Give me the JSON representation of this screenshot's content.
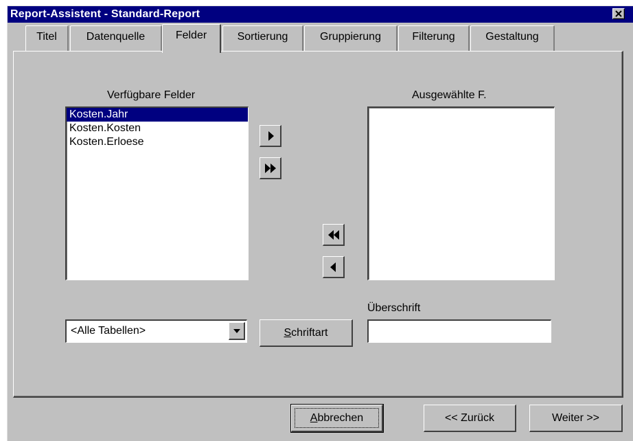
{
  "window": {
    "title": "Report-Assistent - Standard-Report"
  },
  "tabs": [
    {
      "label": "Titel"
    },
    {
      "label": "Datenquelle"
    },
    {
      "label": "Felder",
      "active": true
    },
    {
      "label": "Sortierung"
    },
    {
      "label": "Gruppierung"
    },
    {
      "label": "Filterung"
    },
    {
      "label": "Gestaltung"
    }
  ],
  "fields": {
    "available_label": "Verfügbare Felder",
    "available_items": [
      "Kosten.Jahr",
      "Kosten.Kosten",
      "Kosten.Erloese"
    ],
    "selected_item_index": 0,
    "selected_label": "Ausgewählte F.",
    "selected_items": []
  },
  "table_filter": {
    "value": "<Alle Tabellen>"
  },
  "font_button": {
    "label": "Schriftart",
    "mnemonic": "S"
  },
  "caption": {
    "label": "Überschrift",
    "value": ""
  },
  "footer": {
    "cancel_label": "Abbrechen",
    "cancel_mnemonic": "A",
    "back_label": "<< Zurück",
    "next_label": "Weiter >>"
  },
  "icons": {
    "close": "close-icon",
    "add_one": "arrow-right-icon",
    "add_all": "double-arrow-right-icon",
    "remove_all": "double-arrow-left-icon",
    "remove_one": "arrow-left-icon",
    "dropdown": "chevron-down-icon"
  },
  "colors": {
    "titlebar": "#000080",
    "face": "#c0c0c0",
    "selection": "#000080"
  }
}
